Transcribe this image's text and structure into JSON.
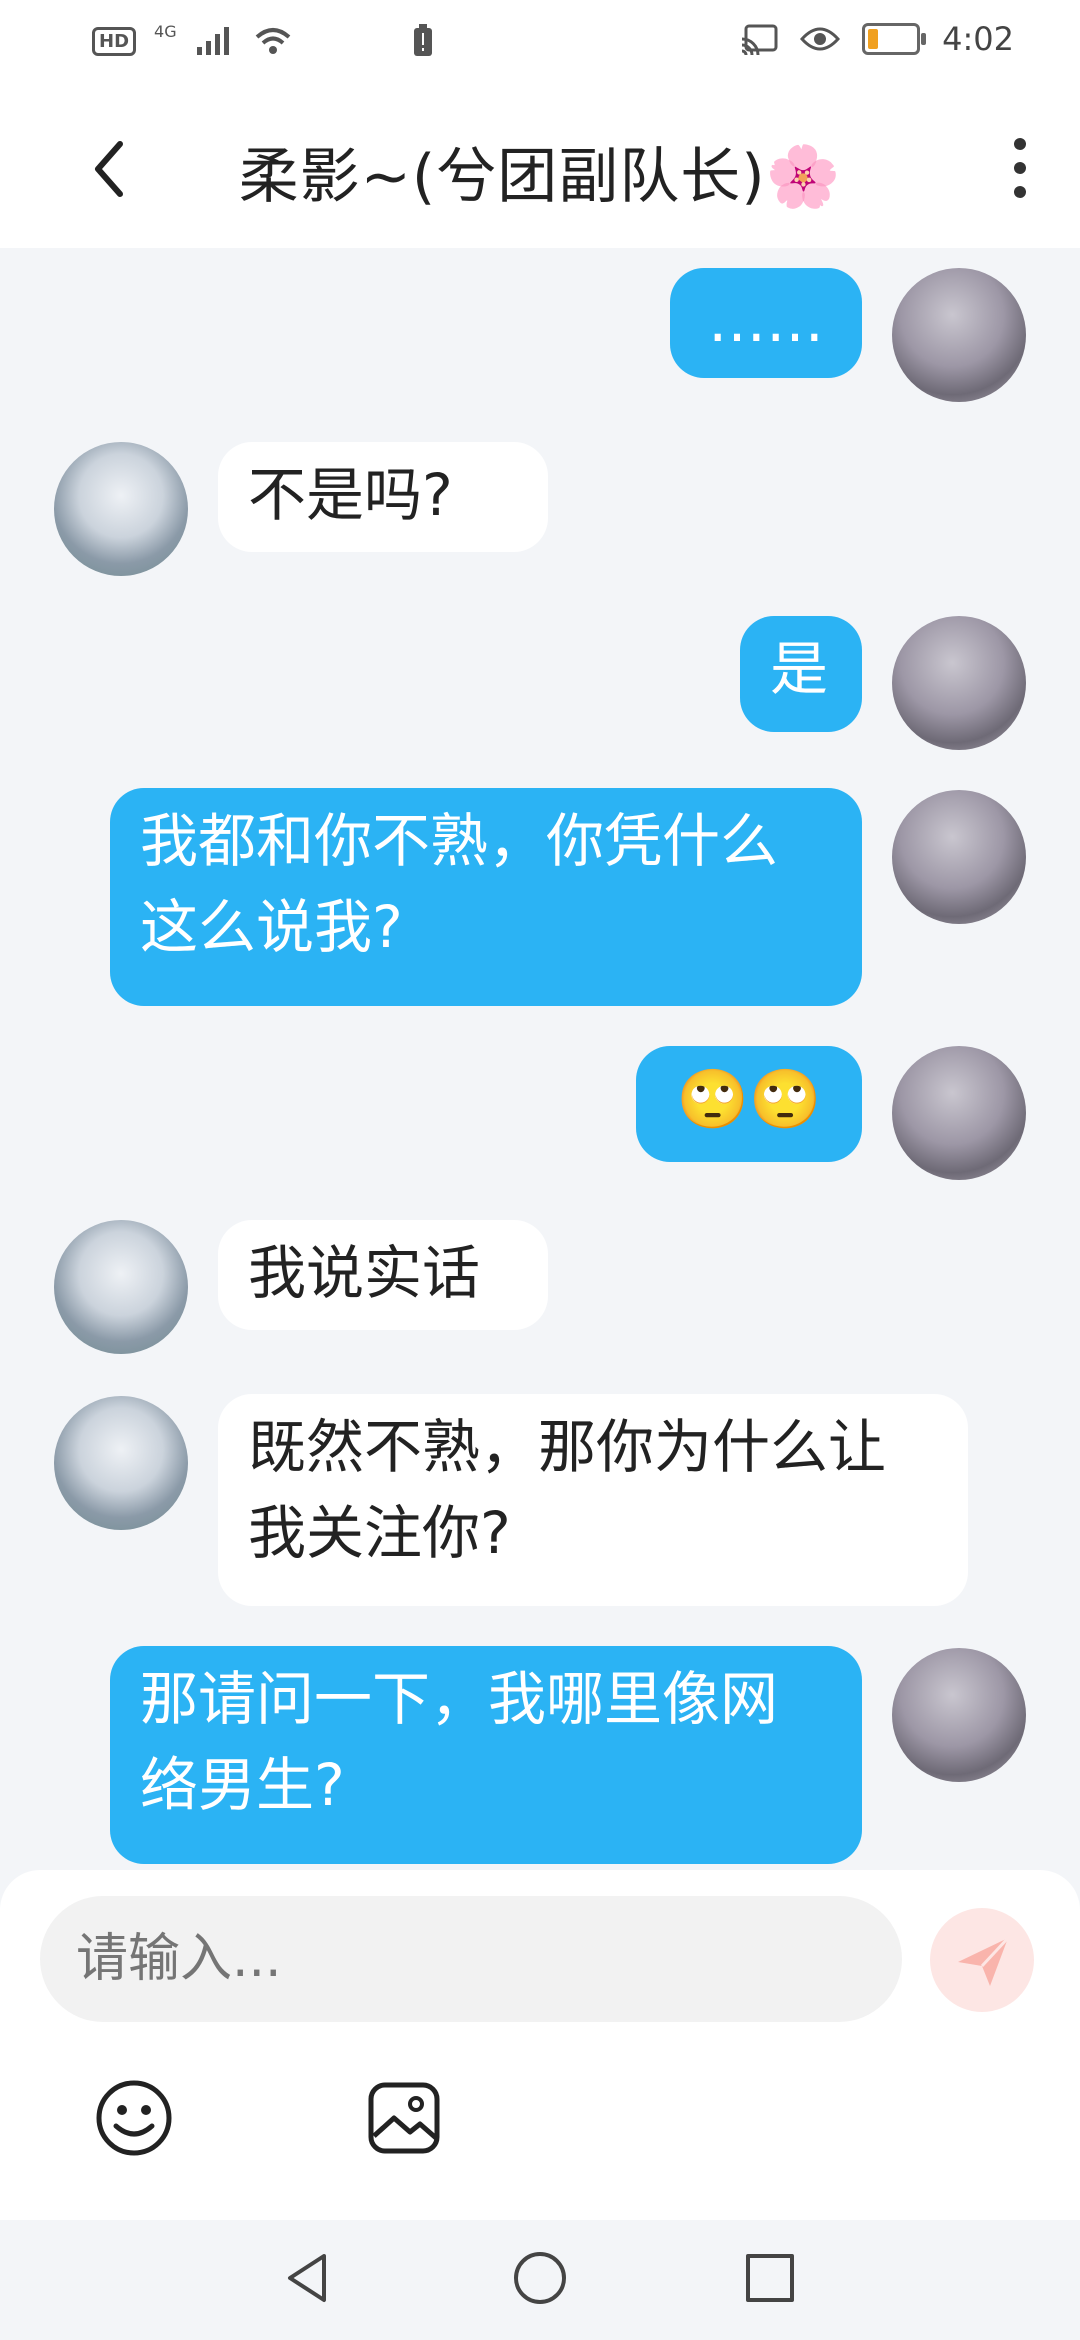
{
  "status_bar": {
    "left_badge": "HD",
    "network": "4G",
    "time": "4:02",
    "battery_color": "#f0a020"
  },
  "header": {
    "title": "柔影~(兮团副队长)🌸"
  },
  "messages": [
    {
      "from": "me",
      "text": "……"
    },
    {
      "from": "her",
      "text": "不是吗?"
    },
    {
      "from": "me",
      "text": "是"
    },
    {
      "from": "me",
      "text": "我都和你不熟，你凭什么这么说我?"
    },
    {
      "from": "me",
      "text": "🙄🙄"
    },
    {
      "from": "her",
      "text": "我说实话"
    },
    {
      "from": "her",
      "text": "既然不熟，那你为什么让我关注你?"
    },
    {
      "from": "me",
      "text": "那请问一下，我哪里像网络男生?"
    }
  ],
  "composer": {
    "placeholder": "请输入...",
    "send_icon": "paper-plane-icon",
    "emoji_icon": "smiley-icon",
    "image_icon": "image-icon"
  },
  "colors": {
    "outgoing_bubble": "#2bb3f4",
    "incoming_bubble": "#ffffff",
    "background": "#f3f5f8"
  }
}
